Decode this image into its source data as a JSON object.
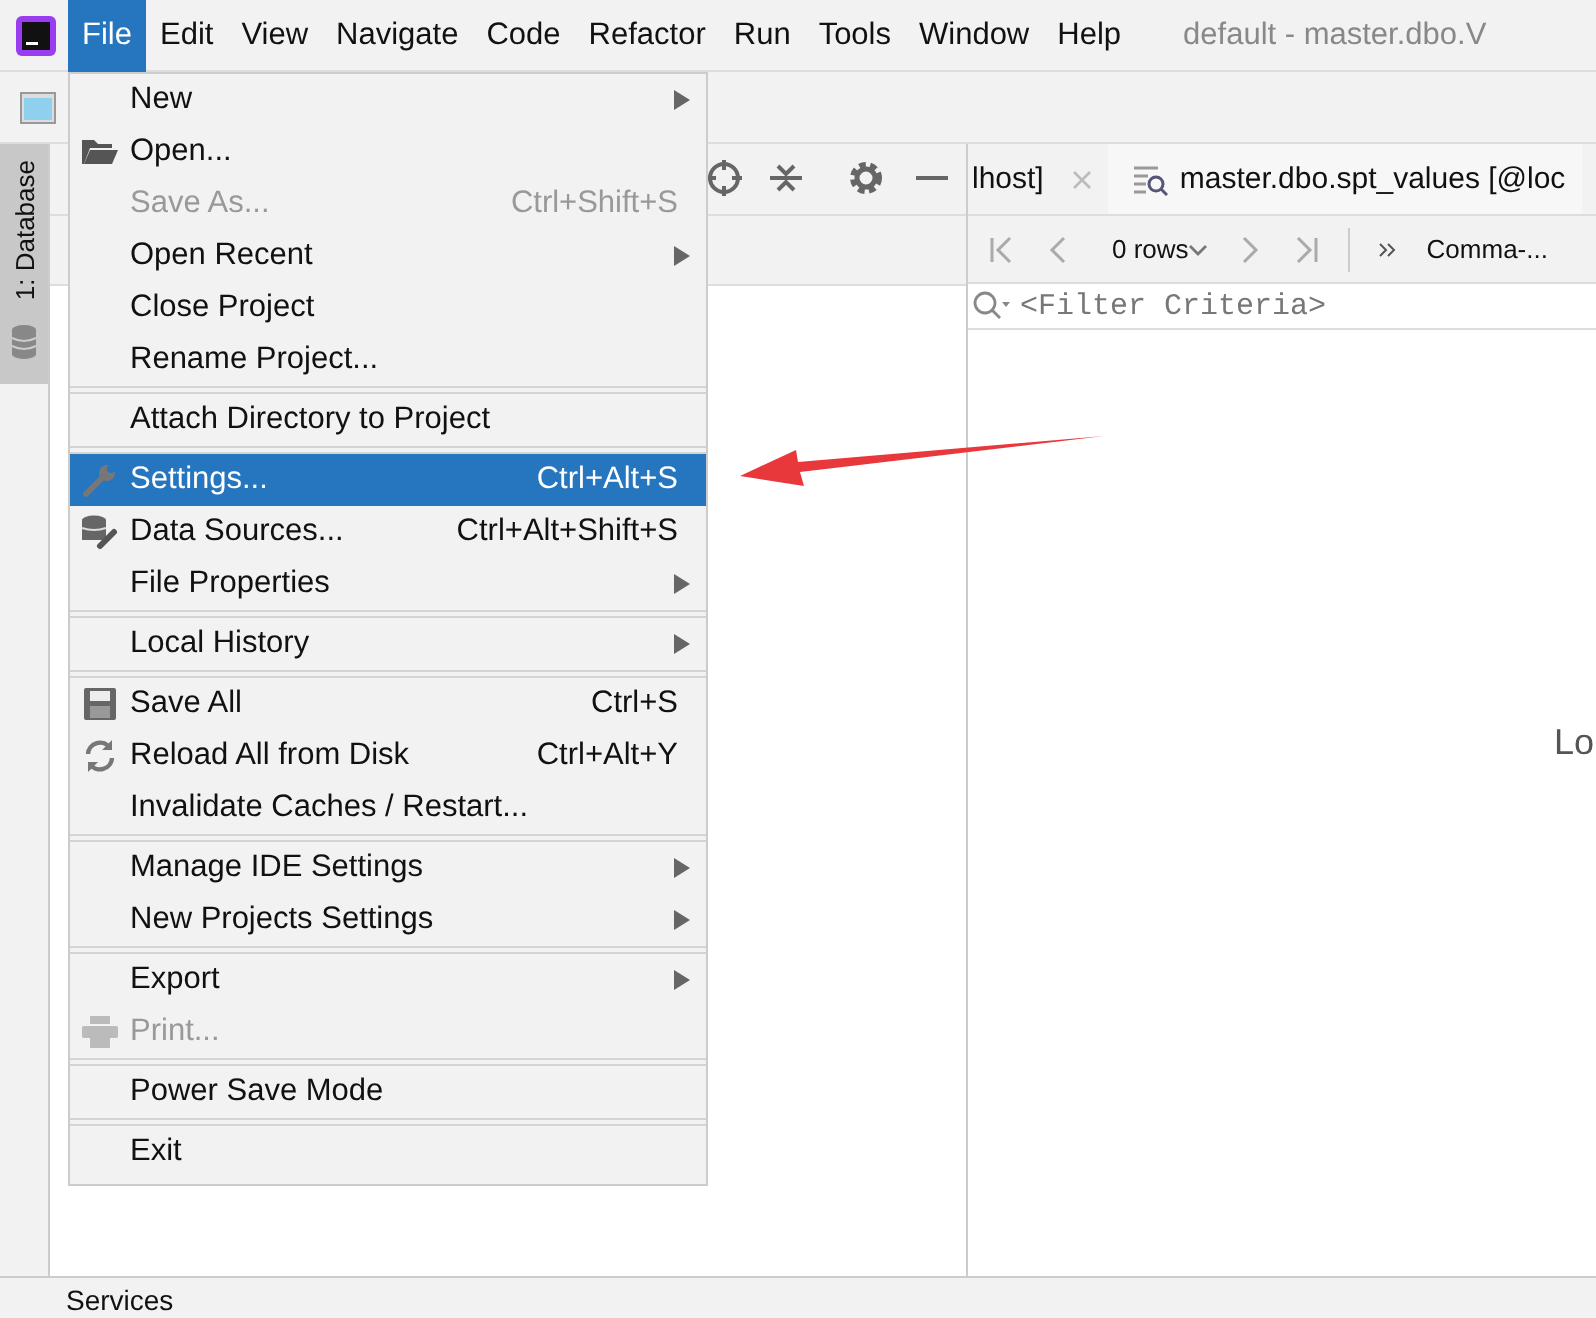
{
  "menu_bar": {
    "items": [
      {
        "label": "File",
        "selected": true
      },
      {
        "label": "Edit",
        "selected": false
      },
      {
        "label": "View",
        "selected": false
      },
      {
        "label": "Navigate",
        "selected": false
      },
      {
        "label": "Code",
        "selected": false
      },
      {
        "label": "Refactor",
        "selected": false
      },
      {
        "label": "Run",
        "selected": false
      },
      {
        "label": "Tools",
        "selected": false
      },
      {
        "label": "Window",
        "selected": false
      },
      {
        "label": "Help",
        "selected": false
      }
    ],
    "title": "default - master.dbo.V"
  },
  "side_tab": {
    "label": "1: Database"
  },
  "editor": {
    "tabs": [
      {
        "label": "lhost]",
        "selected": false,
        "closable": true
      },
      {
        "label": "master.dbo.spt_values [@loc",
        "selected": true,
        "closable": false
      }
    ],
    "rows": "0 rows",
    "format": "Comma-...",
    "filter": {
      "placeholder": "<Filter Criteria>"
    },
    "body_text": "Lo"
  },
  "status_bar": {
    "label": "Services"
  },
  "file_menu": {
    "groups": [
      [
        {
          "label": "New",
          "submenu": true,
          "disabled": false,
          "selected": false
        },
        {
          "label": "Open...",
          "submenu": false,
          "disabled": false,
          "selected": false
        },
        {
          "label": "Save As...",
          "shortcut": "Ctrl+Shift+S",
          "submenu": false,
          "disabled": true,
          "selected": false
        },
        {
          "label": "Open Recent",
          "submenu": true,
          "disabled": false,
          "selected": false
        },
        {
          "label": "Close Project",
          "submenu": false,
          "disabled": false,
          "selected": false
        },
        {
          "label": "Rename Project...",
          "submenu": false,
          "disabled": false,
          "selected": false
        }
      ],
      [
        {
          "label": "Attach Directory to Project",
          "submenu": false,
          "disabled": false,
          "selected": false
        }
      ],
      [
        {
          "label": "Settings...",
          "shortcut": "Ctrl+Alt+S",
          "submenu": false,
          "disabled": false,
          "selected": true
        },
        {
          "label": "Data Sources...",
          "shortcut": "Ctrl+Alt+Shift+S",
          "submenu": false,
          "disabled": false,
          "selected": false
        },
        {
          "label": "File Properties",
          "submenu": true,
          "disabled": false,
          "selected": false
        }
      ],
      [
        {
          "label": "Local History",
          "submenu": true,
          "disabled": false,
          "selected": false
        }
      ],
      [
        {
          "label": "Save All",
          "shortcut": "Ctrl+S",
          "submenu": false,
          "disabled": false,
          "selected": false
        },
        {
          "label": "Reload All from Disk",
          "shortcut": "Ctrl+Alt+Y",
          "submenu": false,
          "disabled": false,
          "selected": false
        },
        {
          "label": "Invalidate Caches / Restart...",
          "submenu": false,
          "disabled": false,
          "selected": false
        }
      ],
      [
        {
          "label": "Manage IDE Settings",
          "submenu": true,
          "disabled": false,
          "selected": false
        },
        {
          "label": "New Projects Settings",
          "submenu": true,
          "disabled": false,
          "selected": false
        }
      ],
      [
        {
          "label": "Export",
          "submenu": true,
          "disabled": false,
          "selected": false
        },
        {
          "label": "Print...",
          "submenu": false,
          "disabled": true,
          "selected": false
        }
      ],
      [
        {
          "label": "Power Save Mode",
          "submenu": false,
          "disabled": false,
          "selected": false
        }
      ],
      [
        {
          "label": "Exit",
          "submenu": false,
          "disabled": false,
          "selected": false
        }
      ]
    ]
  }
}
